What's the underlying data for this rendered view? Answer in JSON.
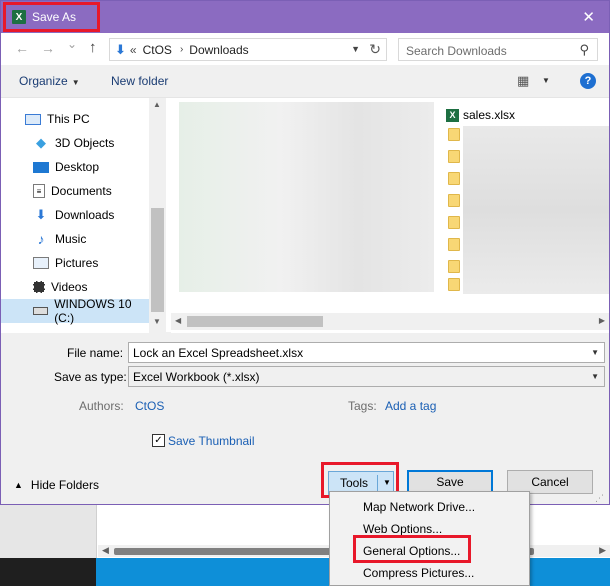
{
  "window": {
    "title": "Save As",
    "close_glyph": "✕",
    "icon": "excel-icon"
  },
  "nav": {
    "back_glyph": "←",
    "forward_glyph": "→",
    "recent_glyph": "⌄",
    "up_glyph": "↑",
    "address": {
      "prefix": "«",
      "crumbs": [
        "CtOS",
        "Downloads"
      ],
      "separator": "›"
    },
    "search_placeholder": "Search Downloads"
  },
  "toolbar": {
    "organize": "Organize",
    "new_folder": "New folder",
    "help": "?"
  },
  "sidebar": {
    "items": [
      {
        "label": "This PC",
        "icon": "computer-icon"
      },
      {
        "label": "3D Objects",
        "icon": "cube-icon"
      },
      {
        "label": "Desktop",
        "icon": "desktop-icon"
      },
      {
        "label": "Documents",
        "icon": "document-icon"
      },
      {
        "label": "Downloads",
        "icon": "download-icon"
      },
      {
        "label": "Music",
        "icon": "music-icon"
      },
      {
        "label": "Pictures",
        "icon": "picture-icon"
      },
      {
        "label": "Videos",
        "icon": "video-icon"
      },
      {
        "label": "WINDOWS 10 (C:)",
        "icon": "drive-icon",
        "selected": true
      }
    ]
  },
  "files": {
    "items": [
      {
        "name": "sales.xlsx",
        "icon": "excel-file-icon"
      }
    ]
  },
  "form": {
    "file_name_label": "File name:",
    "file_name_value": "Lock an Excel Spreadsheet.xlsx",
    "save_as_type_label": "Save as type:",
    "save_as_type_value": "Excel Workbook (*.xlsx)",
    "authors_label": "Authors:",
    "authors_value": "CtOS",
    "tags_label": "Tags:",
    "tags_value": "Add a tag",
    "save_thumbnail_label": "Save Thumbnail",
    "save_thumbnail_checked": true
  },
  "footer": {
    "hide_folders": "Hide Folders",
    "tools": "Tools",
    "save": "Save",
    "cancel": "Cancel"
  },
  "tools_menu": {
    "items": [
      "Map Network Drive...",
      "Web Options...",
      "General Options...",
      "Compress Pictures..."
    ],
    "highlighted": "General Options..."
  },
  "colors": {
    "titlebar": "#8b6bc1",
    "annotation": "#e8182a",
    "link": "#1a5fb4",
    "selected": "#cce4f7"
  }
}
